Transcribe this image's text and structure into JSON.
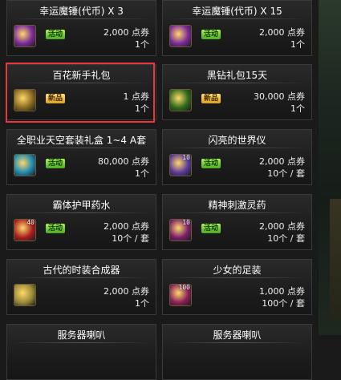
{
  "items": [
    {
      "name": "幸运魔锤(代币) X 3",
      "tag": "活动",
      "tag_type": "activity",
      "price": "2,000 点券",
      "qty": "1个",
      "icon": "hammer-icon",
      "icon_num": "",
      "icon_color": "#7b2b98"
    },
    {
      "name": "幸运魔锤(代币) X 15",
      "tag": "活动",
      "tag_type": "activity",
      "price": "2,000 点券",
      "qty": "1个",
      "icon": "hammer-icon",
      "icon_num": "",
      "icon_color": "#7b2b98"
    },
    {
      "name": "百花新手礼包",
      "tag": "新品",
      "tag_type": "new",
      "price": "1 点券",
      "qty": "1个",
      "icon": "gift-box-icon",
      "icon_num": "",
      "icon_color": "#8a6a22"
    },
    {
      "name": "黑钻礼包15天",
      "tag": "新品",
      "tag_type": "new",
      "price": "30,000 点券",
      "qty": "1个",
      "icon": "gift-bag-icon",
      "icon_num": "",
      "icon_color": "#2f6a1c"
    },
    {
      "name": "全职业天空套装礼盒 1~4 A套",
      "tag": "活动",
      "tag_type": "activity",
      "price": "80,000 点券",
      "qty": "1个",
      "icon": "wing-box-icon",
      "icon_num": "",
      "icon_color": "#1e8ab2"
    },
    {
      "name": "闪亮的世界仪",
      "tag": "活动",
      "tag_type": "activity",
      "price": "2,000 点券",
      "qty": "10个 / 套",
      "icon": "orb-icon",
      "icon_num": "10",
      "icon_color": "#5a3a9a"
    },
    {
      "name": "霸体护甲药水",
      "tag": "活动",
      "tag_type": "activity",
      "price": "2,000 点券",
      "qty": "10个 / 套",
      "icon": "potion-icon",
      "icon_num": "40",
      "icon_color": "#a81e1e"
    },
    {
      "name": "精神刺激灵药",
      "tag": "活动",
      "tag_type": "activity",
      "price": "2,000 点券",
      "qty": "10个 / 套",
      "icon": "elixir-icon",
      "icon_num": "10",
      "icon_color": "#7a1f6a"
    },
    {
      "name": "古代的时装合成器",
      "tag": "",
      "tag_type": "",
      "price": "2,000 点券",
      "qty": "1个",
      "icon": "synth-icon",
      "icon_num": "",
      "icon_color": "#9a8a3a"
    },
    {
      "name": "少女的足装",
      "tag": "",
      "tag_type": "",
      "price": "1,000 点券",
      "qty": "100个 / 套",
      "icon": "shoes-icon",
      "icon_num": "100",
      "icon_color": "#8a1f5a"
    },
    {
      "name": "服务器喇叭",
      "tag": "",
      "tag_type": "",
      "price": "",
      "qty": "",
      "icon": "",
      "icon_num": "",
      "icon_color": ""
    },
    {
      "name": "服务器喇叭",
      "tag": "",
      "tag_type": "",
      "price": "",
      "qty": "",
      "icon": "",
      "icon_num": "",
      "icon_color": ""
    }
  ]
}
